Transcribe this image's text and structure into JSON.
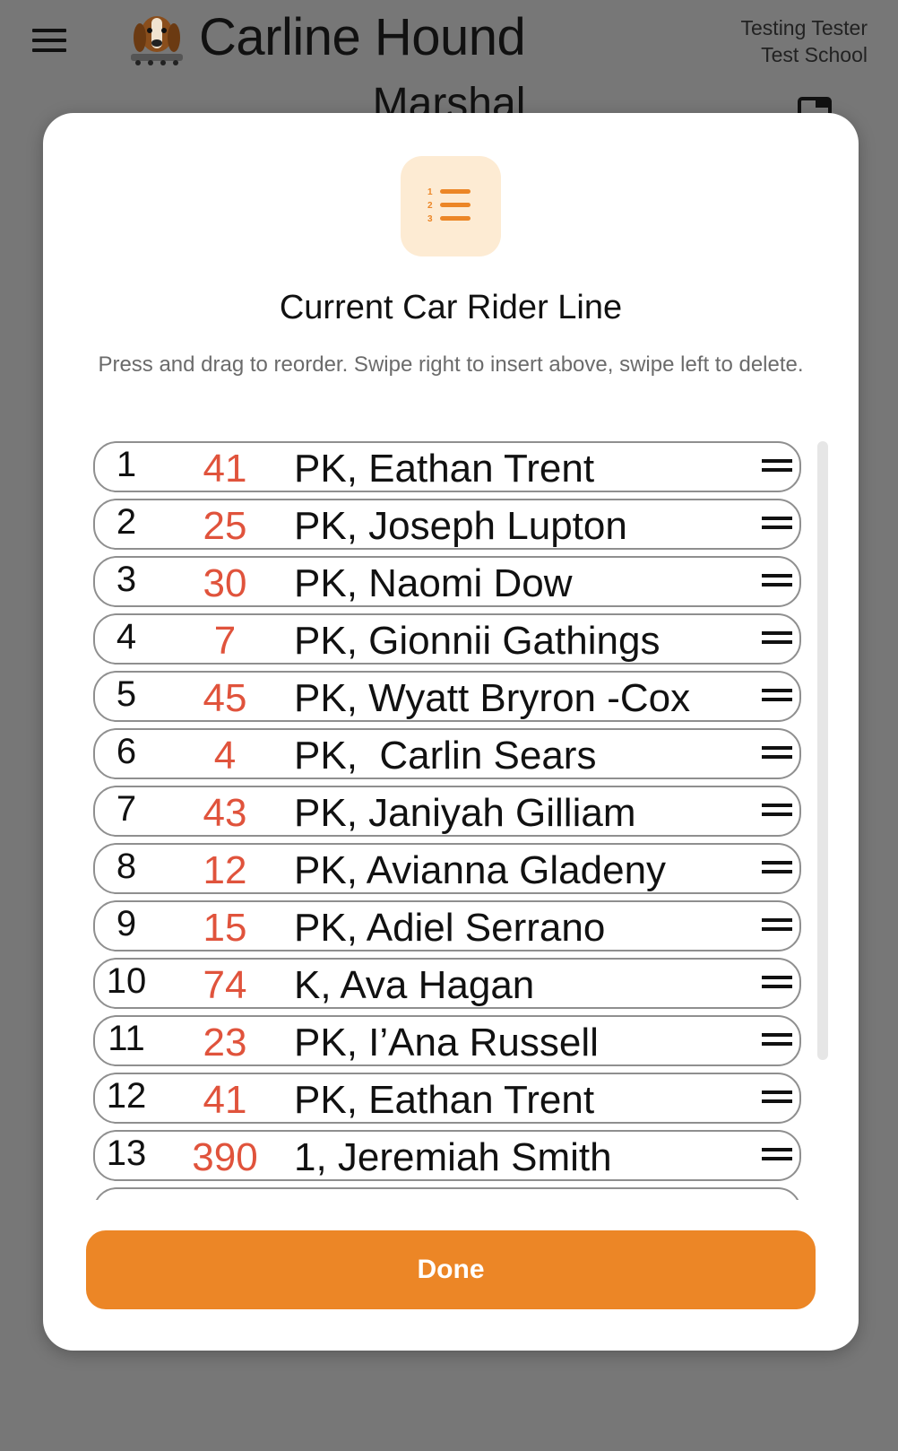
{
  "app": {
    "title": "Carline Hound",
    "page_title": "Marshal",
    "user_name": "Testing Tester",
    "school_name": "Test School"
  },
  "icons": {
    "menu": "hamburger-menu-icon",
    "logo": "hound-logo",
    "corner": "layout-icon",
    "list": "numbered-list-icon",
    "drag": "drag-handle-icon"
  },
  "colors": {
    "accent": "#ec8626",
    "accent_light": "#fdebd3",
    "car_number": "#e0533c"
  },
  "modal": {
    "title": "Current Car Rider Line",
    "hint": "Press and drag to reorder. Swipe right to insert above, swipe left to delete.",
    "done_label": "Done",
    "rows": [
      {
        "pos": "1",
        "car": "41",
        "name": "PK, Eathan Trent"
      },
      {
        "pos": "2",
        "car": "25",
        "name": "PK, Joseph Lupton"
      },
      {
        "pos": "3",
        "car": "30",
        "name": "PK, Naomi Dow"
      },
      {
        "pos": "4",
        "car": "7",
        "name": "PK, Gionnii Gathings"
      },
      {
        "pos": "5",
        "car": "45",
        "name": "PK, Wyatt Bryron -Cox"
      },
      {
        "pos": "6",
        "car": "4",
        "name": "PK,  Carlin Sears"
      },
      {
        "pos": "7",
        "car": "43",
        "name": "PK, Janiyah Gilliam"
      },
      {
        "pos": "8",
        "car": "12",
        "name": "PK, Avianna Gladeny"
      },
      {
        "pos": "9",
        "car": "15",
        "name": "PK, Adiel Serrano"
      },
      {
        "pos": "10",
        "car": "74",
        "name": "K, Ava Hagan"
      },
      {
        "pos": "11",
        "car": "23",
        "name": "PK, I’Ana Russell"
      },
      {
        "pos": "12",
        "car": "41",
        "name": "PK, Eathan Trent"
      },
      {
        "pos": "13",
        "car": "390",
        "name": "1, Jeremiah Smith"
      },
      {
        "pos": "",
        "car": "",
        "name": ""
      }
    ]
  }
}
